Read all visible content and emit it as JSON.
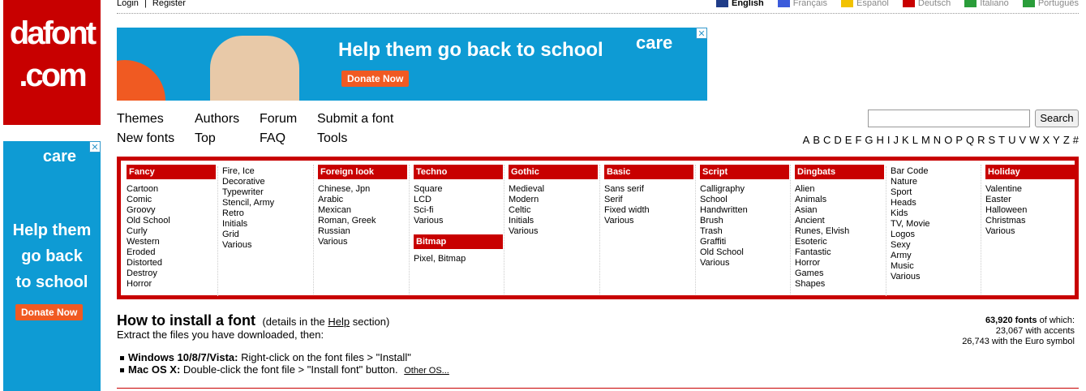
{
  "logo": {
    "line1": "dafont",
    "line2": ".com"
  },
  "topbar": {
    "login": "Login",
    "sep": "|",
    "register": "Register",
    "languages": [
      {
        "label": "English",
        "active": true,
        "flag": "#1f3c88"
      },
      {
        "label": "Français",
        "active": false,
        "flag": "#3b5bdb"
      },
      {
        "label": "Español",
        "active": false,
        "flag": "#f2c200"
      },
      {
        "label": "Deutsch",
        "active": false,
        "flag": "#c80000"
      },
      {
        "label": "Italiano",
        "active": false,
        "flag": "#2a9d3a"
      },
      {
        "label": "Português",
        "active": false,
        "flag": "#2a9d3a"
      }
    ]
  },
  "banner": {
    "headline": "Help them go back to school",
    "brand": "care",
    "donate": "Donate Now",
    "close": "✕"
  },
  "side_ad": {
    "brand": "care",
    "line1": "Help them",
    "line2": "go back",
    "line3": "to school",
    "donate": "Donate Now",
    "close": "✕"
  },
  "menu": {
    "themes": "Themes",
    "authors": "Authors",
    "forum": "Forum",
    "submit": "Submit a font",
    "new_fonts": "New fonts",
    "top": "Top",
    "faq": "FAQ",
    "tools": "Tools"
  },
  "search": {
    "button": "Search",
    "placeholder": ""
  },
  "alphabet": [
    "A",
    "B",
    "C",
    "D",
    "E",
    "F",
    "G",
    "H",
    "I",
    "J",
    "K",
    "L",
    "M",
    "N",
    "O",
    "P",
    "Q",
    "R",
    "S",
    "T",
    "U",
    "V",
    "W",
    "X",
    "Y",
    "Z",
    "#"
  ],
  "categories": {
    "fancy": {
      "title": "Fancy",
      "items": [
        "Cartoon",
        "Comic",
        "Groovy",
        "Old School",
        "Curly",
        "Western",
        "Eroded",
        "Distorted",
        "Destroy",
        "Horror"
      ]
    },
    "fancy2": {
      "items": [
        "Fire, Ice",
        "Decorative",
        "Typewriter",
        "Stencil, Army",
        "Retro",
        "Initials",
        "Grid",
        "Various"
      ]
    },
    "foreign": {
      "title": "Foreign look",
      "items": [
        "Chinese, Jpn",
        "Arabic",
        "Mexican",
        "Roman, Greek",
        "Russian",
        "Various"
      ]
    },
    "techno": {
      "title": "Techno",
      "items": [
        "Square",
        "LCD",
        "Sci-fi",
        "Various"
      ]
    },
    "bitmap": {
      "title": "Bitmap",
      "items": [
        "Pixel, Bitmap"
      ]
    },
    "gothic": {
      "title": "Gothic",
      "items": [
        "Medieval",
        "Modern",
        "Celtic",
        "Initials",
        "Various"
      ]
    },
    "basic": {
      "title": "Basic",
      "items": [
        "Sans serif",
        "Serif",
        "Fixed width",
        "Various"
      ]
    },
    "script": {
      "title": "Script",
      "items": [
        "Calligraphy",
        "School",
        "Handwritten",
        "Brush",
        "Trash",
        "Graffiti",
        "Old School",
        "Various"
      ]
    },
    "dingbats": {
      "title": "Dingbats",
      "items": [
        "Alien",
        "Animals",
        "Asian",
        "Ancient",
        "Runes, Elvish",
        "Esoteric",
        "Fantastic",
        "Horror",
        "Games",
        "Shapes"
      ]
    },
    "dingbats2": {
      "items": [
        "Bar Code",
        "Nature",
        "Sport",
        "Heads",
        "Kids",
        "TV, Movie",
        "Logos",
        "Sexy",
        "Army",
        "Music",
        "Various"
      ]
    },
    "holiday": {
      "title": "Holiday",
      "items": [
        "Valentine",
        "Easter",
        "Halloween",
        "Christmas",
        "Various"
      ]
    }
  },
  "install": {
    "title": "How to install a font",
    "details_pre": "(details in the ",
    "details_link": "Help",
    "details_post": " section)",
    "intro": "Extract the files you have downloaded, then:",
    "windows_label": "Windows 10/8/7/Vista:",
    "windows_text": " Right-click on the font files > \"Install\"",
    "mac_label": "Mac OS X:",
    "mac_text": " Double-click the font file > \"Install font\" button.",
    "other_os": "Other OS..."
  },
  "stats": {
    "count": "63,920 fonts",
    "of_which": " of which:",
    "accents": "23,067 with accents",
    "euro": "26,743 with the Euro symbol"
  }
}
